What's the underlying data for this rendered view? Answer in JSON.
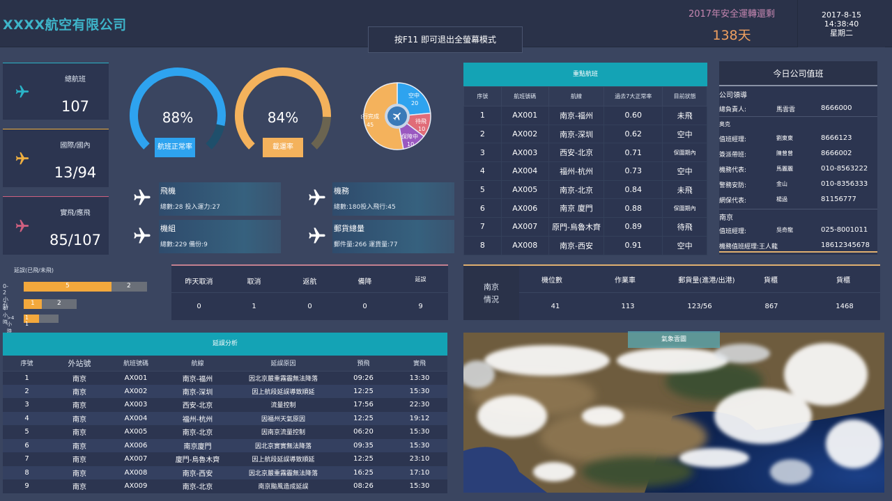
{
  "header": {
    "title": "XXXX航空有限公司",
    "f11_hint": "按F11 即可退出全螢幕模式",
    "safety_label": "2017年安全運轉還剩",
    "safety_days": "138天",
    "date": "2017-8-15",
    "time": "14:38:40",
    "weekday": "星期二"
  },
  "stats": [
    {
      "label": "總航班",
      "value": "107",
      "color": "#2ab4c8"
    },
    {
      "label": "國際/國內",
      "value": "13/94",
      "color": "#f0b040"
    },
    {
      "label": "實飛/應飛",
      "value": "85/107",
      "color": "#d06080"
    }
  ],
  "gauges": [
    {
      "value": 88,
      "text": "88%",
      "label": "航班正常率",
      "color": "#2ea3ef"
    },
    {
      "value": 84,
      "text": "84%",
      "label": "載運率",
      "color": "#f4b25c"
    }
  ],
  "pie": {
    "labels": {
      "air": "空中",
      "air_val": "20",
      "takeoff": "待飛",
      "takeoff_val": "10",
      "guard": "保障中",
      "guard_val": "10",
      "done": "執行完成",
      "done_val": "45"
    },
    "slices": [
      {
        "name": "空中",
        "value": 20,
        "color": "#2ea3ef"
      },
      {
        "name": "待飛",
        "value": 10,
        "color": "#e06c78"
      },
      {
        "name": "保障中",
        "value": 10,
        "color": "#9a58c0"
      },
      {
        "name": "執行完成",
        "value": 45,
        "color": "#f4b25c"
      }
    ]
  },
  "resources": [
    {
      "title": "飛機",
      "sub": "總數:28 投入運力:27"
    },
    {
      "title": "機務",
      "sub": "總數:180投入飛行:45"
    },
    {
      "title": "機組",
      "sub": "總數:229 備份:9"
    },
    {
      "title": "郵貨總量",
      "sub": "郵件量:266 運貨量:77"
    }
  ],
  "key_flights": {
    "title": "重點航班",
    "headers": [
      "序號",
      "航班號碼",
      "航線",
      "過去7大正常率",
      "目前狀態"
    ],
    "rows": [
      [
        "1",
        "AX001",
        "南京-福州",
        "0.60",
        "未飛"
      ],
      [
        "2",
        "AX002",
        "南京-深圳",
        "0.62",
        "空中"
      ],
      [
        "3",
        "AX003",
        "西安-北京",
        "0.71",
        "保圍期內"
      ],
      [
        "4",
        "AX004",
        "福州-杭州",
        "0.73",
        "空中"
      ],
      [
        "5",
        "AX005",
        "南京-北京",
        "0.84",
        "未飛"
      ],
      [
        "6",
        "AX006",
        "南京 廈門",
        "0.88",
        "保圍期內"
      ],
      [
        "7",
        "AX007",
        "原門-烏魯木齊",
        "0.89",
        "待飛"
      ],
      [
        "8",
        "AX008",
        "南京-西安",
        "0.91",
        "空中"
      ]
    ]
  },
  "duty": {
    "title": "今日公司值班",
    "section1": "公司領導",
    "r1_label": "總負責人:",
    "r1_name": "馬雲雲",
    "r1_phone": "8666000",
    "section2": "奥克",
    "rows": [
      {
        "label": "值班經理:",
        "name": "劉東東",
        "phone": "8666123"
      },
      {
        "label": "簽派帶班:",
        "name": "陳曾曾",
        "phone": "8666002"
      },
      {
        "label": "機務代表:",
        "name": "馬麗麗",
        "phone": "010-8563222"
      },
      {
        "label": "警務安防:",
        "name": "金山",
        "phone": "010-8356333"
      },
      {
        "label": "網保代表:",
        "name": "楊過",
        "phone": "81156777"
      }
    ],
    "section3": "南京",
    "rows2": [
      {
        "label": "值班經理:",
        "name": "吳奇龍",
        "phone": "025-8001011"
      },
      {
        "label": "機務值班經理:王人龍",
        "name": "",
        "phone": "18612345678"
      }
    ]
  },
  "delay_chart": {
    "title": "延誤(已飛/未飛)",
    "rows": [
      {
        "label": "0-2小時",
        "flown": 5,
        "unflown": 2
      },
      {
        "label": "2-4小時",
        "flown": 1,
        "unflown": 2
      },
      {
        "label": ">4小時",
        "flown": 1,
        "unflown": 1
      }
    ],
    "row3_text": "1 1"
  },
  "cancel": {
    "headers": [
      "昨天取消",
      "取消",
      "返航",
      "備降",
      "延誤"
    ],
    "values": [
      "0",
      "1",
      "0",
      "0",
      "9"
    ]
  },
  "nanjing": {
    "label1": "南京",
    "label2": "情況",
    "headers": [
      "機位數",
      "作業車",
      "郵貨量(進港/出港)",
      "貨櫃",
      "貨櫃"
    ],
    "values": [
      "41",
      "113",
      "123/56",
      "867",
      "1468"
    ]
  },
  "delay_table": {
    "title": "延誤分析",
    "headers": [
      "序號",
      "外站號",
      "航班號碼",
      "航線",
      "延誤原因",
      "預飛",
      "實飛"
    ],
    "rows": [
      [
        "1",
        "南京",
        "AX001",
        "南京-福州",
        "因北京嚴重霧霾無法降落",
        "09:26",
        "13:30"
      ],
      [
        "2",
        "南京",
        "AX002",
        "南京-深圳",
        "因上航段延誤導致順延",
        "12:25",
        "15:30"
      ],
      [
        "3",
        "南京",
        "AX003",
        "西安-北京",
        "流量控制",
        "17:56",
        "22:30"
      ],
      [
        "4",
        "南京",
        "AX004",
        "福州-杭州",
        "因福州天氣原因",
        "12:25",
        "19:12"
      ],
      [
        "5",
        "南京",
        "AX005",
        "南京-北京",
        "因南京流量控制",
        "06:20",
        "15:30"
      ],
      [
        "6",
        "南京",
        "AX006",
        "南京廈門",
        "因北京實實無法降落",
        "09:35",
        "15:30"
      ],
      [
        "7",
        "南京",
        "AX007",
        "廈門-烏魯木齊",
        "因上航段延誤導致順延",
        "12:25",
        "23:10"
      ],
      [
        "8",
        "南京",
        "AX008",
        "南京-西安",
        "因北京嚴重霧霾無法降落",
        "16:25",
        "17:10"
      ],
      [
        "9",
        "南京",
        "AX009",
        "南京-北京",
        "南京颱風造成延誤",
        "08:26",
        "15:30"
      ]
    ]
  },
  "weather": {
    "title": "氣象雲圖"
  }
}
